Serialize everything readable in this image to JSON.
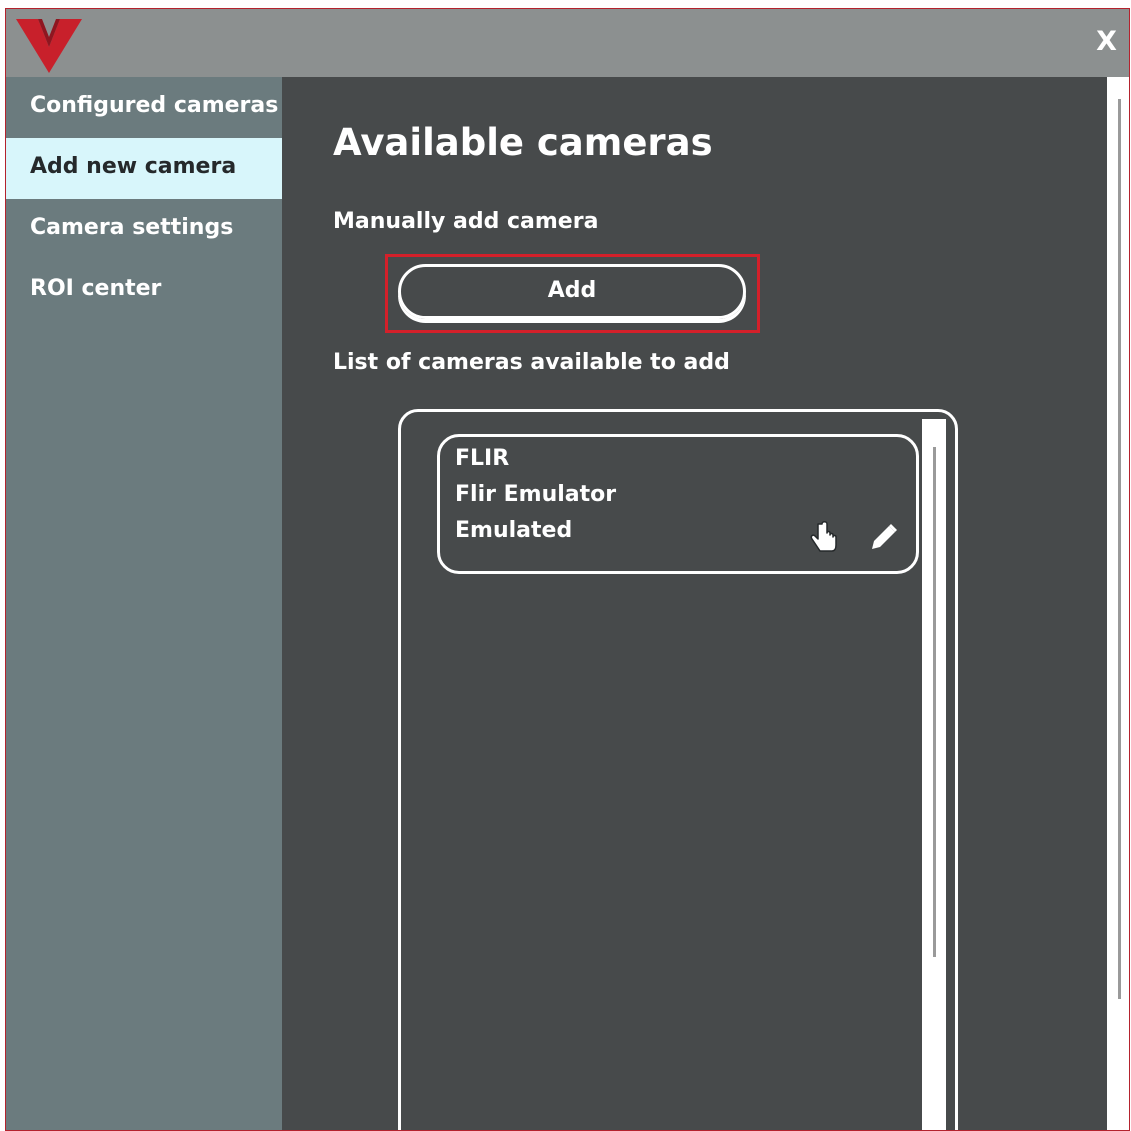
{
  "window": {
    "close_label": "X",
    "accent_color": "#b4222d"
  },
  "sidebar": {
    "items": [
      {
        "label": "Configured cameras",
        "active": false
      },
      {
        "label": "Add new camera",
        "active": true
      },
      {
        "label": "Camera settings",
        "active": false
      },
      {
        "label": "ROI center",
        "active": false
      }
    ]
  },
  "main": {
    "title": "Available cameras",
    "manual_heading": "Manually add camera",
    "add_button_label": "Add",
    "list_heading": "List of cameras available to add",
    "cameras": [
      {
        "vendor": "FLIR",
        "model": "Flir Emulator",
        "type": "Emulated",
        "icons": [
          "hand-pointer-icon",
          "pencil-edit-icon"
        ]
      }
    ]
  },
  "colors": {
    "titlebar": "#8c9090",
    "sidebar": "#6b7b7e",
    "sidebar_active": "#d8f6fb",
    "content": "#474a4b",
    "highlight": "#d4202a"
  }
}
